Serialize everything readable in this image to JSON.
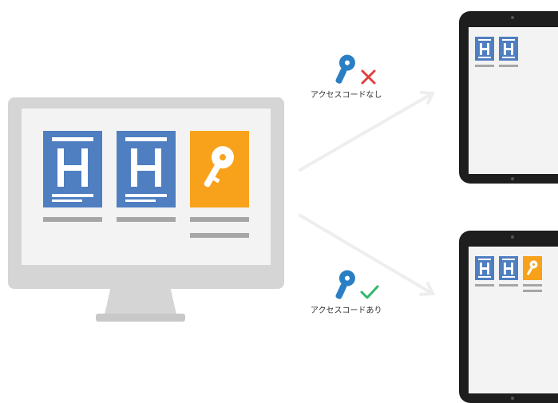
{
  "labels": {
    "no_access": "アクセスコードなし",
    "with_access": "アクセスコードあり"
  },
  "icons": {
    "key": "key-icon",
    "deny": "x-mark-icon",
    "allow": "checkmark-icon"
  },
  "colors": {
    "tile_blue": "#4f7ec1",
    "tile_orange": "#f8a21c",
    "key_blue": "#2a7fc4",
    "deny_red": "#e04040",
    "allow_green": "#2eb86a",
    "device_dark": "#1e1e1e",
    "monitor_gray": "#d5d5d5"
  }
}
